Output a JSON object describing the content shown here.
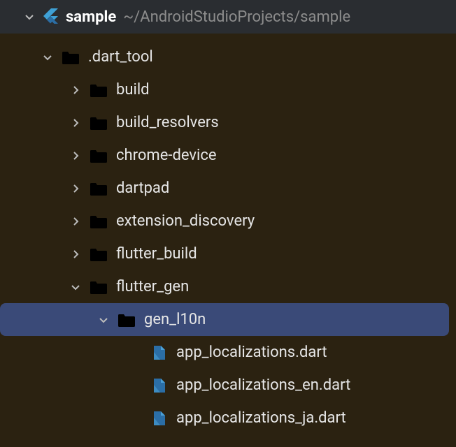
{
  "header": {
    "project_name": "sample",
    "project_path": "~/AndroidStudioProjects/sample"
  },
  "tree": {
    "root": {
      "label": ".dart_tool",
      "children": {
        "build": {
          "label": "build"
        },
        "build_resolvers": {
          "label": "build_resolvers"
        },
        "chrome_device": {
          "label": "chrome-device"
        },
        "dartpad": {
          "label": "dartpad"
        },
        "extension_discovery": {
          "label": "extension_discovery"
        },
        "flutter_build": {
          "label": "flutter_build"
        },
        "flutter_gen": {
          "label": "flutter_gen",
          "children": {
            "gen_l10n": {
              "label": "gen_l10n",
              "files": {
                "app_localizations": {
                  "label": "app_localizations.dart"
                },
                "app_localizations_en": {
                  "label": "app_localizations_en.dart"
                },
                "app_localizations_ja": {
                  "label": "app_localizations_ja.dart"
                }
              }
            }
          }
        }
      }
    }
  }
}
